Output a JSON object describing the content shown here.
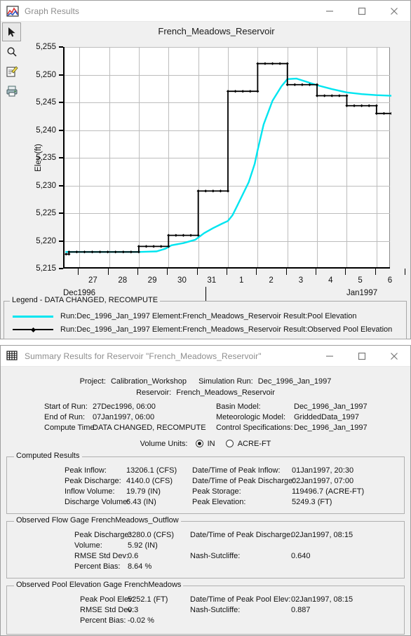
{
  "graph_window": {
    "title": "Graph Results",
    "icon": "graph-results-icon",
    "controls": {
      "minimize": "minimize",
      "maximize": "maximize",
      "close": "close"
    },
    "toolbar": [
      {
        "name": "pointer-tool",
        "glyph": "arrow",
        "selected": true
      },
      {
        "name": "zoom-tool",
        "glyph": "magnifier",
        "selected": false
      },
      {
        "name": "edit-properties-tool",
        "glyph": "edit-note",
        "selected": false
      },
      {
        "name": "print-tool",
        "glyph": "printer",
        "selected": false
      }
    ],
    "legend": {
      "title": "Legend - DATA CHANGED, RECOMPUTE",
      "entries": [
        {
          "label": "Run:Dec_1996_Jan_1997 Element:French_Meadows_Reservoir Result:Pool Elevation",
          "color": "#00e5f0",
          "marker": false
        },
        {
          "label": "Run:Dec_1996_Jan_1997 Element:French_Meadows_Reservoir Result:Observed Pool Elevation",
          "color": "#000000",
          "marker": true
        }
      ]
    }
  },
  "chart_data": {
    "type": "line",
    "title": "French_Meadows_Reservoir",
    "xlabel": "",
    "ylabel": "Elev (ft)",
    "ylim": [
      5215,
      5255
    ],
    "yticks": [
      5215,
      5220,
      5225,
      5230,
      5235,
      5240,
      5245,
      5250,
      5255
    ],
    "ytick_labels": [
      "5,215",
      "5,220",
      "5,225",
      "5,230",
      "5,235",
      "5,240",
      "5,245",
      "5,250",
      "5,255"
    ],
    "xticks": [
      "27",
      "28",
      "29",
      "30",
      "31",
      "1",
      "2",
      "3",
      "4",
      "5",
      "6"
    ],
    "xgroup_left": "Dec1996",
    "xgroup_right": "Jan1997",
    "xlim": [
      26.5,
      6.5
    ],
    "grid": true,
    "legend_position": "below-plot",
    "series": [
      {
        "name": "Run:Dec_1996_Jan_1997 Element:French_Meadows_Reservoir Result:Pool Elevation",
        "color": "#00e5f0",
        "style": "smooth",
        "x": [
          26.55,
          27.0,
          28.0,
          29.0,
          29.6,
          29.9,
          30.1,
          30.5,
          30.9,
          31.0,
          31.2,
          31.5,
          31.8,
          32.0,
          32.15,
          32.3,
          32.5,
          32.7,
          32.9,
          33.0,
          33.2,
          33.5,
          33.8,
          34.0,
          34.3,
          34.6,
          35.0,
          35.5,
          36.0,
          36.5,
          37.0,
          37.5,
          38.0
        ],
        "y": [
          5218.0,
          5218.0,
          5218.0,
          5218.0,
          5218.1,
          5218.6,
          5219.2,
          5219.6,
          5220.2,
          5220.6,
          5221.4,
          5222.3,
          5223.1,
          5223.6,
          5224.6,
          5226.2,
          5228.4,
          5230.6,
          5233.9,
          5236.4,
          5241.0,
          5245.3,
          5247.9,
          5249.2,
          5249.3,
          5248.8,
          5248.1,
          5247.4,
          5246.8,
          5246.5,
          5246.3,
          5246.2,
          5246.2
        ]
      },
      {
        "name": "Run:Dec_1996_Jan_1997 Element:French_Meadows_Reservoir Result:Observed Pool Elevation",
        "color": "#000000",
        "style": "step",
        "markers": true,
        "steps": [
          {
            "x0": 26.55,
            "x1": 26.65,
            "y": 5217.6
          },
          {
            "x0": 26.65,
            "x1": 29.0,
            "y": 5218.0
          },
          {
            "x0": 29.0,
            "x1": 30.0,
            "y": 5219.0
          },
          {
            "x0": 30.0,
            "x1": 31.0,
            "y": 5221.0
          },
          {
            "x0": 31.0,
            "x1": 32.0,
            "y": 5229.0
          },
          {
            "x0": 32.0,
            "x1": 33.0,
            "y": 5247.0
          },
          {
            "x0": 33.0,
            "x1": 34.0,
            "y": 5252.0
          },
          {
            "x0": 34.0,
            "x1": 35.0,
            "y": 5248.2
          },
          {
            "x0": 35.0,
            "x1": 36.0,
            "y": 5246.2
          },
          {
            "x0": 36.0,
            "x1": 37.0,
            "y": 5244.4
          },
          {
            "x0": 37.0,
            "x1": 38.0,
            "y": 5243.0
          }
        ]
      }
    ]
  },
  "summary_window": {
    "title": "Summary Results for Reservoir \"French_Meadows_Reservoir\"",
    "icon": "table-icon",
    "header": {
      "project_label": "Project:",
      "project_value": "Calibration_Workshop",
      "sim_run_label": "Simulation Run:",
      "sim_run_value": "Dec_1996_Jan_1997",
      "reservoir_label": "Reservoir:",
      "reservoir_value": "French_Meadows_Reservoir"
    },
    "run_info": {
      "start_label": "Start of Run:",
      "start_value": "27Dec1996, 06:00",
      "end_label": "End of Run:",
      "end_value": "07Jan1997, 06:00",
      "compute_label": "Compute Time:",
      "compute_value": "DATA CHANGED, RECOMPUTE",
      "basin_label": "Basin Model:",
      "basin_value": "Dec_1996_Jan_1997",
      "met_label": "Meteorologic Model:",
      "met_value": "GriddedData_1997",
      "ctrl_label": "Control Specifications:",
      "ctrl_value": "Dec_1996_Jan_1997"
    },
    "volume_units": {
      "label": "Volume Units:",
      "options": [
        {
          "label": "IN",
          "selected": true
        },
        {
          "label": "ACRE-FT",
          "selected": false
        }
      ]
    },
    "computed_results": {
      "title": "Computed Results",
      "rows": [
        {
          "l1": "Peak Inflow:",
          "v1": "13206.1 (CFS)",
          "l2": "Date/Time of Peak Inflow:",
          "v2": "01Jan1997, 20:30"
        },
        {
          "l1": "Peak Discharge:",
          "v1": "4140.0 (CFS)",
          "l2": "Date/Time of Peak Discharge:",
          "v2": "02Jan1997, 07:00"
        },
        {
          "l1": "Inflow Volume:",
          "v1": "19.79 (IN)",
          "l2": "Peak Storage:",
          "v2": "119496.7 (ACRE-FT)"
        },
        {
          "l1": "Discharge Volume:",
          "v1": "6.43 (IN)",
          "l2": "Peak Elevation:",
          "v2": "5249.3 (FT)"
        }
      ]
    },
    "observed_flow": {
      "title": "Observed Flow Gage FrenchMeadows_Outflow",
      "rows": [
        {
          "l1": "Peak Discharge:",
          "v1": "3280.0 (CFS)",
          "l2": "Date/Time of Peak Discharge:",
          "v2": "02Jan1997, 08:15"
        },
        {
          "l1": "Volume:",
          "v1": "5.92 (IN)",
          "l2": "",
          "v2": ""
        },
        {
          "l1": "RMSE Std Dev:",
          "v1": "0.6",
          "l2": "Nash-Sutcliffe:",
          "v2": "0.640"
        },
        {
          "l1": "Percent Bias:",
          "v1": "8.64 %",
          "l2": "",
          "v2": ""
        }
      ]
    },
    "observed_pool": {
      "title": "Observed Pool Elevation Gage FrenchMeadows",
      "rows": [
        {
          "l1": "Peak Pool Elev:",
          "v1": "5252.1 (FT)",
          "l2": "Date/Time of Peak Pool Elev:",
          "v2": "02Jan1997, 08:15"
        },
        {
          "l1": "RMSE Std Dev:",
          "v1": "0.3",
          "l2": "Nash-Sutcliffe:",
          "v2": "0.887"
        },
        {
          "l1": "Percent Bias:",
          "v1": "-0.02 %",
          "l2": "",
          "v2": ""
        }
      ]
    }
  }
}
